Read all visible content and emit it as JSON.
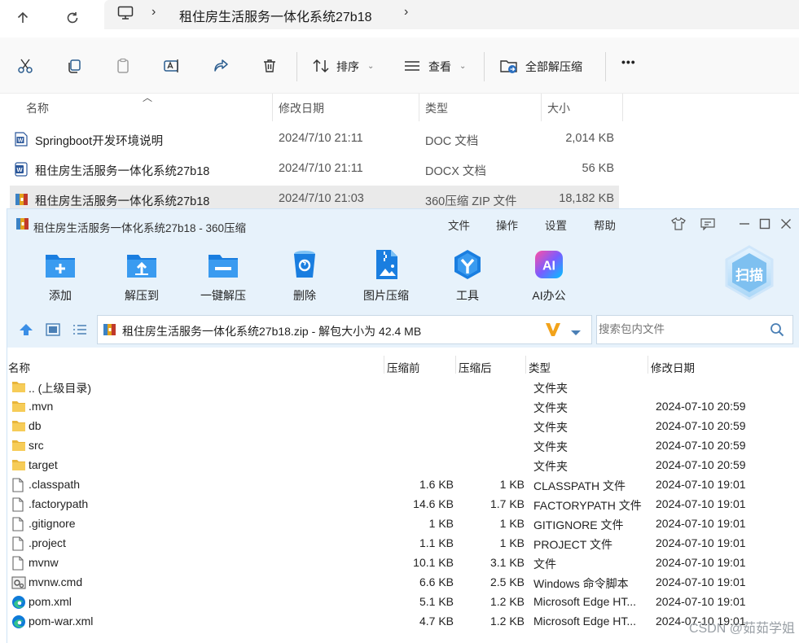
{
  "explorer": {
    "breadcrumb": "租住房生活服务一体化系统27b18",
    "toolbar": {
      "sort_label": "排序",
      "view_label": "查看",
      "extract_all_label": "全部解压缩",
      "more_label": "•••"
    },
    "columns": {
      "name": "名称",
      "modified": "修改日期",
      "type": "类型",
      "size": "大小"
    },
    "files": [
      {
        "name": "Springboot开发环境说明",
        "modified": "2024/7/10 21:11",
        "type": "DOC 文档",
        "size": "2,014 KB",
        "icon": "word-doc-icon"
      },
      {
        "name": "租住房生活服务一体化系统27b18",
        "modified": "2024/7/10 21:11",
        "type": "DOCX 文档",
        "size": "56 KB",
        "icon": "word-docx-icon"
      },
      {
        "name": "租住房生活服务一体化系统27b18",
        "modified": "2024/7/10 21:03",
        "type": "360压缩 ZIP 文件",
        "size": "18,182 KB",
        "icon": "zip-archive-icon",
        "selected": true
      }
    ]
  },
  "archiver": {
    "title": "租住房生活服务一体化系统27b18 - 360压缩",
    "menu": [
      "文件",
      "操作",
      "设置",
      "帮助"
    ],
    "tools": [
      {
        "label": "添加",
        "icon": "add-icon"
      },
      {
        "label": "解压到",
        "icon": "extract-to-icon"
      },
      {
        "label": "一键解压",
        "icon": "one-click-extract-icon"
      },
      {
        "label": "删除",
        "icon": "recycle-bin-icon"
      },
      {
        "label": "图片压缩",
        "icon": "image-compress-icon"
      },
      {
        "label": "工具",
        "icon": "tools-icon"
      },
      {
        "label": "AI办公",
        "icon": "ai-office-icon"
      }
    ],
    "scan_label": "扫描",
    "path_text": "租住房生活服务一体化系统27b18.zip - 解包大小为 42.4 MB",
    "search_placeholder": "搜索包内文件",
    "columns": {
      "name": "名称",
      "before": "压缩前",
      "after": "压缩后",
      "type": "类型",
      "modified": "修改日期"
    },
    "entries": [
      {
        "name": ".. (上级目录)",
        "before": "",
        "after": "",
        "type": "文件夹",
        "modified": "",
        "icon": "folder-icon"
      },
      {
        "name": ".mvn",
        "before": "",
        "after": "",
        "type": "文件夹",
        "modified": "2024-07-10 20:59",
        "icon": "folder-icon"
      },
      {
        "name": "db",
        "before": "",
        "after": "",
        "type": "文件夹",
        "modified": "2024-07-10 20:59",
        "icon": "folder-icon"
      },
      {
        "name": "src",
        "before": "",
        "after": "",
        "type": "文件夹",
        "modified": "2024-07-10 20:59",
        "icon": "folder-icon"
      },
      {
        "name": "target",
        "before": "",
        "after": "",
        "type": "文件夹",
        "modified": "2024-07-10 20:59",
        "icon": "folder-icon"
      },
      {
        "name": ".classpath",
        "before": "1.6 KB",
        "after": "1 KB",
        "type": "CLASSPATH 文件",
        "modified": "2024-07-10 19:01",
        "icon": "file-icon"
      },
      {
        "name": ".factorypath",
        "before": "14.6 KB",
        "after": "1.7 KB",
        "type": "FACTORYPATH 文件",
        "modified": "2024-07-10 19:01",
        "icon": "file-icon"
      },
      {
        "name": ".gitignore",
        "before": "1 KB",
        "after": "1 KB",
        "type": "GITIGNORE 文件",
        "modified": "2024-07-10 19:01",
        "icon": "file-icon"
      },
      {
        "name": ".project",
        "before": "1.1 KB",
        "after": "1 KB",
        "type": "PROJECT 文件",
        "modified": "2024-07-10 19:01",
        "icon": "file-icon"
      },
      {
        "name": "mvnw",
        "before": "10.1 KB",
        "after": "3.1 KB",
        "type": "文件",
        "modified": "2024-07-10 19:01",
        "icon": "file-icon"
      },
      {
        "name": "mvnw.cmd",
        "before": "6.6 KB",
        "after": "2.5 KB",
        "type": "Windows 命令脚本",
        "modified": "2024-07-10 19:01",
        "icon": "cmd-script-icon"
      },
      {
        "name": "pom.xml",
        "before": "5.1 KB",
        "after": "1.2 KB",
        "type": "Microsoft Edge HT...",
        "modified": "2024-07-10 19:01",
        "icon": "edge-icon"
      },
      {
        "name": "pom-war.xml",
        "before": "4.7 KB",
        "after": "1.2 KB",
        "type": "Microsoft Edge HT...",
        "modified": "2024-07-10 19:01",
        "icon": "edge-icon"
      }
    ]
  },
  "watermark": "CSDN @茹茹学姐"
}
